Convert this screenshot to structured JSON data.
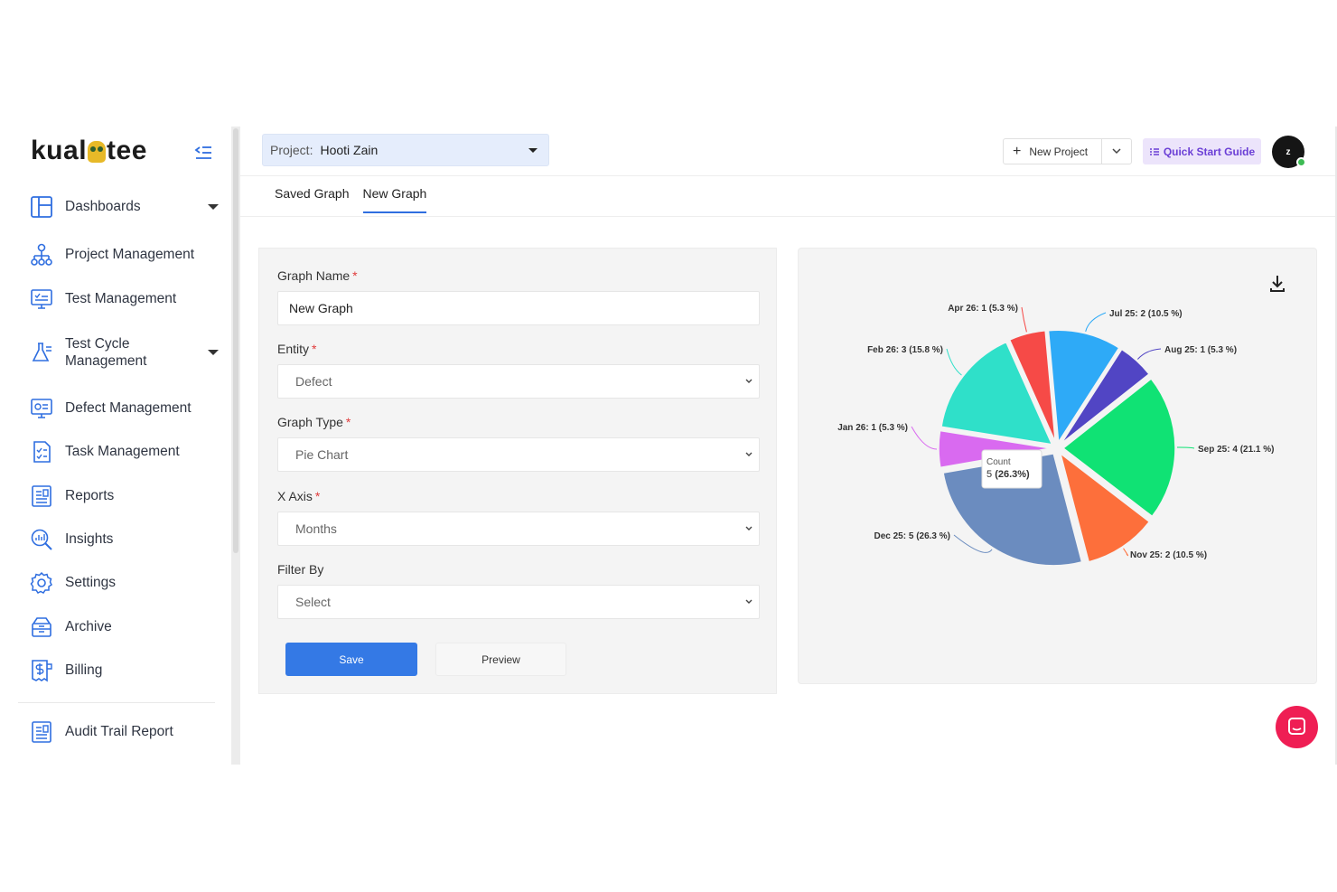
{
  "brand": {
    "logo_left": "kual",
    "logo_right": "tee"
  },
  "sidebar": {
    "items": [
      {
        "label": "Dashboards",
        "icon": "dashboard-icon",
        "has_caret": true
      },
      {
        "label": "Project Management",
        "icon": "project-management-icon"
      },
      {
        "label": "Test Management",
        "icon": "test-management-icon"
      },
      {
        "label": "Test Cycle Management",
        "label_line1": "Test Cycle",
        "label_line2": "Management",
        "icon": "flask-icon",
        "has_caret": true
      },
      {
        "label": "Defect Management",
        "icon": "defect-management-icon"
      },
      {
        "label": "Task Management",
        "icon": "task-management-icon"
      },
      {
        "label": "Reports",
        "icon": "reports-icon"
      },
      {
        "label": "Insights",
        "icon": "insights-icon"
      },
      {
        "label": "Settings",
        "icon": "gear-icon"
      },
      {
        "label": "Archive",
        "icon": "archive-icon"
      },
      {
        "label": "Billing",
        "icon": "billing-icon"
      },
      {
        "label": "Audit Trail Report",
        "icon": "audit-trail-icon"
      }
    ]
  },
  "header": {
    "project_label": "Project:",
    "project_value": "Hooti Zain",
    "new_project_label": "New Project",
    "quick_start_label": "Quick Start Guide",
    "avatar_initial": "z"
  },
  "tabs": [
    {
      "label": "Saved Graph",
      "active": false
    },
    {
      "label": "New Graph",
      "active": true
    }
  ],
  "form": {
    "graph_name_label": "Graph Name",
    "graph_name_value": "New Graph",
    "entity_label": "Entity",
    "entity_value": "Defect",
    "graph_type_label": "Graph Type",
    "graph_type_value": "Pie Chart",
    "x_axis_label": "X Axis",
    "x_axis_value": "Months",
    "filter_by_label": "Filter By",
    "filter_by_value": "Select",
    "required_mark": "*",
    "save_label": "Save",
    "preview_label": "Preview"
  },
  "tooltip": {
    "title": "Count",
    "value_prefix": "5",
    "value_pct": "(26.3%)"
  },
  "colors": {
    "accent": "#3479e5",
    "quick_start": "#6b3fd6",
    "chat": "#ef1e54"
  },
  "chart_data": {
    "type": "pie",
    "slices": [
      {
        "label": "Jul 25",
        "value": 2,
        "pct": "10.5 %",
        "color": "#2eaaf7",
        "display": "Jul 25: 2 (10.5 %)"
      },
      {
        "label": "Aug 25",
        "value": 1,
        "pct": "5.3 %",
        "color": "#5145c4",
        "display": "Aug 25: 1 (5.3 %)"
      },
      {
        "label": "Sep 25",
        "value": 4,
        "pct": "21.1 %",
        "color": "#10e274",
        "display": "Sep 25: 4 (21.1 %)"
      },
      {
        "label": "Nov 25",
        "value": 2,
        "pct": "10.5 %",
        "color": "#fd6f3b",
        "display": "Nov 25: 2 (10.5 %)"
      },
      {
        "label": "Dec 25",
        "value": 5,
        "pct": "26.3 %",
        "color": "#6b8cbf",
        "display": "Dec 25: 5 (26.3 %)"
      },
      {
        "label": "Jan 26",
        "value": 1,
        "pct": "5.3 %",
        "color": "#d96af0",
        "display": "Jan 26: 1 (5.3 %)"
      },
      {
        "label": "Feb 26",
        "value": 3,
        "pct": "15.8 %",
        "color": "#2fe0c9",
        "display": "Feb 26: 3 (15.8 %)"
      },
      {
        "label": "Apr 26",
        "value": 1,
        "pct": "5.3 %",
        "color": "#f64a47",
        "display": "Apr 26: 1 (5.3 %)"
      }
    ]
  }
}
